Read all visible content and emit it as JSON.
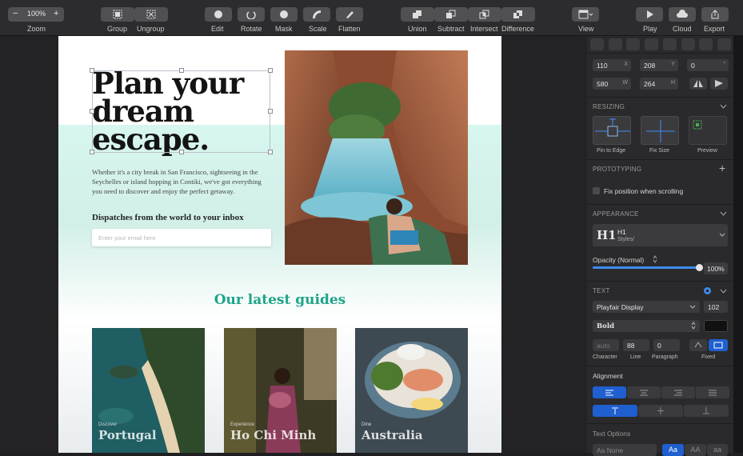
{
  "toolbar": {
    "zoom": {
      "value": "100%",
      "label": "Zoom",
      "minus": "−",
      "plus": "+"
    },
    "group": "Group",
    "ungroup": "Ungroup",
    "edit": "Edit",
    "rotate": "Rotate",
    "mask": "Mask",
    "scale": "Scale",
    "flatten": "Flatten",
    "union": "Union",
    "subtract": "Subtract",
    "intersect": "Intersect",
    "difference": "Difference",
    "view": "View",
    "play": "Play",
    "cloud": "Cloud",
    "export": "Export"
  },
  "artboard": {
    "hero_title_lines": [
      "Plan your",
      "dream",
      "escape."
    ],
    "hero_desc": "Whether it's a city break in San Francisco, sightseeing in the Seychelles or island hopping in Contiki, we've got everything you need to discover and enjoy the perfect getaway.",
    "dispatch": "Dispatches from the world to your inbox",
    "email_placeholder": "Enter your email here",
    "guides_title": "Our latest guides",
    "cards": [
      {
        "category": "Discover",
        "name": "Portugal"
      },
      {
        "category": "Experience",
        "name": "Ho Chi Minh"
      },
      {
        "category": "Dine",
        "name": "Australia"
      }
    ]
  },
  "inspector": {
    "position": {
      "x": "110",
      "x_unit": "X",
      "y": "208",
      "y_unit": "Y",
      "rotation": "0",
      "rotation_unit": "°"
    },
    "size": {
      "w": "580",
      "w_unit": "W",
      "h": "264",
      "h_unit": "H"
    },
    "resizing": {
      "title": "RESIZING",
      "pin": "Pin to Edge",
      "fix": "Fix Size",
      "preview": "Preview"
    },
    "prototyping": {
      "title": "PROTOTYPING",
      "add": "+",
      "fix_scroll": "Fix position when scrolling"
    },
    "appearance": {
      "title": "APPEARANCE",
      "style_icon": "H1",
      "style_name": "H1",
      "style_path": "Styles/",
      "opacity_label": "Opacity (Normal)",
      "opacity_value": "100%",
      "opacity_fraction": 1.0
    },
    "text": {
      "title": "TEXT",
      "font": "Playfair Display",
      "size": "102",
      "weight": "Bold",
      "color": "#111111",
      "character_value": "auto",
      "line_value": "88",
      "paragraph_value": "0",
      "character_label": "Character",
      "line_label": "Line",
      "paragraph_label": "Paragraph",
      "fixed_label": "Fixed"
    },
    "alignment": {
      "title": "Alignment"
    },
    "text_options": {
      "title": "Text Options",
      "decoration": "Aa None",
      "case1": "Aa",
      "case2": "AA",
      "case3": "aa"
    }
  },
  "colors": {
    "accent": "#1f5fcf",
    "teal": "#1fa48a"
  }
}
